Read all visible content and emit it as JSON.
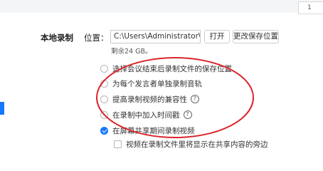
{
  "corner_label": "1",
  "section_title": "本地录制",
  "location_label": "位置：",
  "location_path": "C:\\Users\\Administrator\\Docume",
  "open_button": "打开",
  "change_location_button": "更改保存位置",
  "remaining_space": "剩余24 GB。",
  "options": [
    {
      "label": "选择会议结束后录制文件的保存位置",
      "checked": false
    },
    {
      "label": "为每个发言者单独录制音轨",
      "checked": false
    },
    {
      "label": "提高录制视频的兼容性",
      "checked": false,
      "help": "?"
    },
    {
      "label": "在录制中加入时间戳",
      "checked": false,
      "help": "?"
    },
    {
      "label": "在屏幕共享期间录制视频",
      "checked": true
    },
    {
      "label": "视频在录制文件里将显示在共享内容的旁边",
      "checked": false
    }
  ],
  "colors": {
    "accent": "#1677ff",
    "annotation": "#d9252b"
  }
}
